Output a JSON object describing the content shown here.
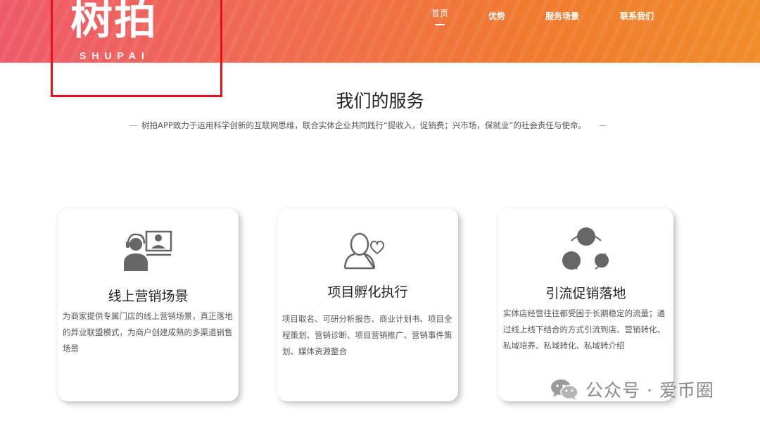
{
  "logo": {
    "main": "树拍",
    "sub": "SHUPAI"
  },
  "nav": [
    {
      "label": "首页",
      "active": true
    },
    {
      "label": "优势",
      "active": false
    },
    {
      "label": "服务场景",
      "active": false
    },
    {
      "label": "联系我们",
      "active": false
    }
  ],
  "section": {
    "title": "我们的服务",
    "subtitle_dash_left": "—",
    "subtitle": "树拍APP致力于运用科学创新的互联网思维，联合实体企业共同践行“提收入，促销费；兴市场，保就业”的社会责任与使命。",
    "subtitle_dash_right": "—"
  },
  "cards": [
    {
      "icon": "customer-service-screen-icon",
      "title": "线上营销场景",
      "desc": "为商家提供专属门店的线上营销场景，真正落地的异业联盟模式，为商户创建成熟的多渠道销售场景"
    },
    {
      "icon": "user-heart-icon",
      "title": "项目孵化执行",
      "desc": "项目取名、可研分析报告、商业计划书、项目全程策划、营销诊断、项目营销推广、营销事件策划、媒体资源整合"
    },
    {
      "icon": "traffic-share-icon",
      "title": "引流促销落地",
      "desc": "实体店经营往往都受困于长期稳定的流量；通过线上线下结合的方式引流到店、营销转化、私域培养、私域转化、私域转介绍"
    }
  ],
  "watermark": {
    "icon": "wechat-icon",
    "text": "公众号 · 爱币圈"
  },
  "colors": {
    "header_start": "#ee5a6a",
    "header_end": "#f08c2a",
    "highlight": "#e8101a",
    "icon_gray": "#666666"
  }
}
